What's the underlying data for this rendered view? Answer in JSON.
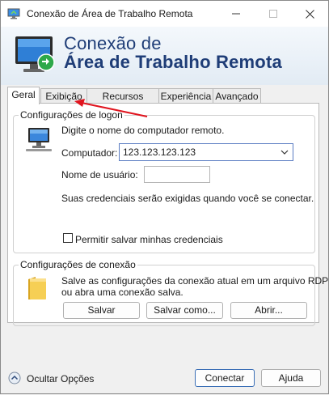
{
  "window": {
    "title": "Conexão de Área de Trabalho Remota",
    "controls": {
      "minimize": "—",
      "maximize": "☐",
      "close": "✕"
    }
  },
  "banner": {
    "line1": "Conexão de",
    "line2": "Área de Trabalho Remota",
    "icon": "remote-desktop-monitor-icon"
  },
  "tabs": [
    {
      "label": "Geral",
      "active": true
    },
    {
      "label": "Exibição",
      "active": false
    },
    {
      "label": "Recursos Locais",
      "active": false
    },
    {
      "label": "Experiência",
      "active": false
    },
    {
      "label": "Avançado",
      "active": false
    }
  ],
  "logon": {
    "group_title": "Configurações de logon",
    "instruction": "Digite o nome do computador remoto.",
    "computer_label": "Computador:",
    "computer_value": "123.123.123.123",
    "username_label": "Nome de usuário:",
    "username_value": "",
    "credentials_note": "Suas credenciais serão exigidas quando você se conectar.",
    "save_credentials_label": "Permitir salvar minhas credenciais",
    "save_credentials_checked": false
  },
  "connection": {
    "group_title": "Configurações de conexão",
    "description_line1": "Salve as configurações da conexão atual em um arquivo RDP",
    "description_line2": "ou abra uma conexão salva.",
    "save_label": "Salvar",
    "save_as_label": "Salvar como...",
    "open_label": "Abrir..."
  },
  "footer": {
    "hide_options_label": "Ocultar Opções",
    "connect_label": "Conectar",
    "help_label": "Ajuda"
  },
  "colors": {
    "banner_text": "#1f3d77",
    "annotation_arrow": "#e0141e",
    "primary_button_border": "#3b6fb6"
  }
}
